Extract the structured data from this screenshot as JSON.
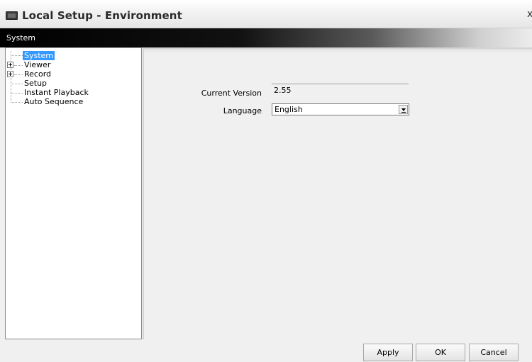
{
  "window": {
    "title": "Local Setup - Environment",
    "close_glyph": "x"
  },
  "header": {
    "title": "System"
  },
  "tree": {
    "items": [
      {
        "label": "System",
        "selected": true,
        "expandable": false
      },
      {
        "label": "Viewer",
        "selected": false,
        "expandable": true
      },
      {
        "label": "Record",
        "selected": false,
        "expandable": true
      },
      {
        "label": "Setup",
        "selected": false,
        "expandable": false
      },
      {
        "label": "Instant Playback",
        "selected": false,
        "expandable": false
      },
      {
        "label": "Auto Sequence",
        "selected": false,
        "expandable": false
      }
    ]
  },
  "form": {
    "current_version_label": "Current Version",
    "current_version_value": "2.55",
    "language_label": "Language",
    "language_value": "English"
  },
  "buttons": {
    "apply": "Apply",
    "ok": "OK",
    "cancel": "Cancel"
  },
  "colors": {
    "selection": "#3399ff",
    "header_band": "#000000"
  }
}
